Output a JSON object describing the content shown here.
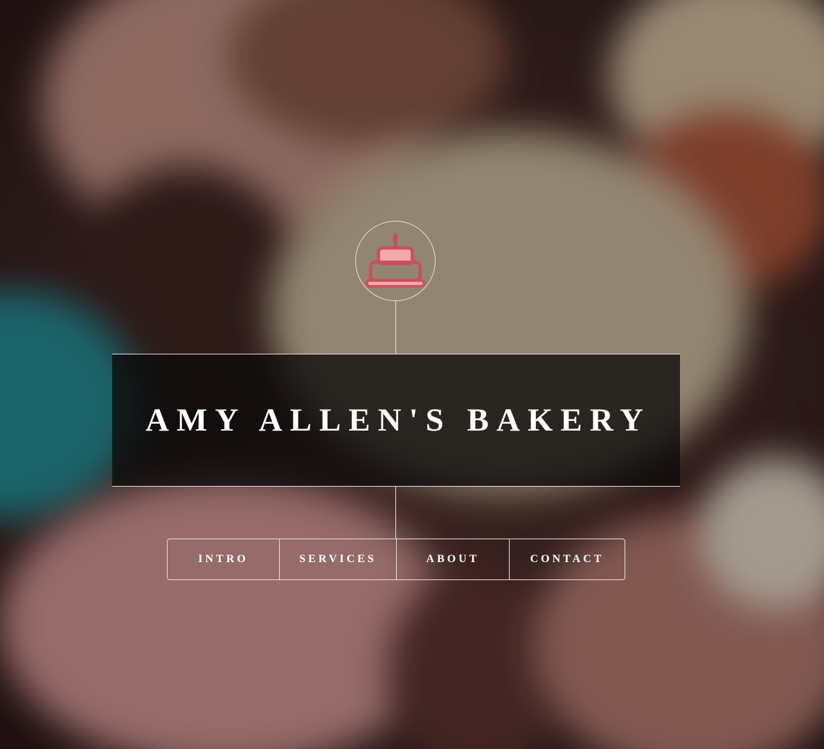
{
  "header": {
    "logo_icon": "birthday-cake-icon",
    "title": "AMY ALLEN'S BAKERY"
  },
  "nav": {
    "items": [
      {
        "label": "INTRO"
      },
      {
        "label": "SERVICES"
      },
      {
        "label": "ABOUT"
      },
      {
        "label": "CONTACT"
      }
    ]
  },
  "colors": {
    "icon_accent": "#c9505b",
    "icon_fill": "#f4a9ad",
    "line": "#e9e2e0",
    "title_box": "#0c0a0a"
  }
}
